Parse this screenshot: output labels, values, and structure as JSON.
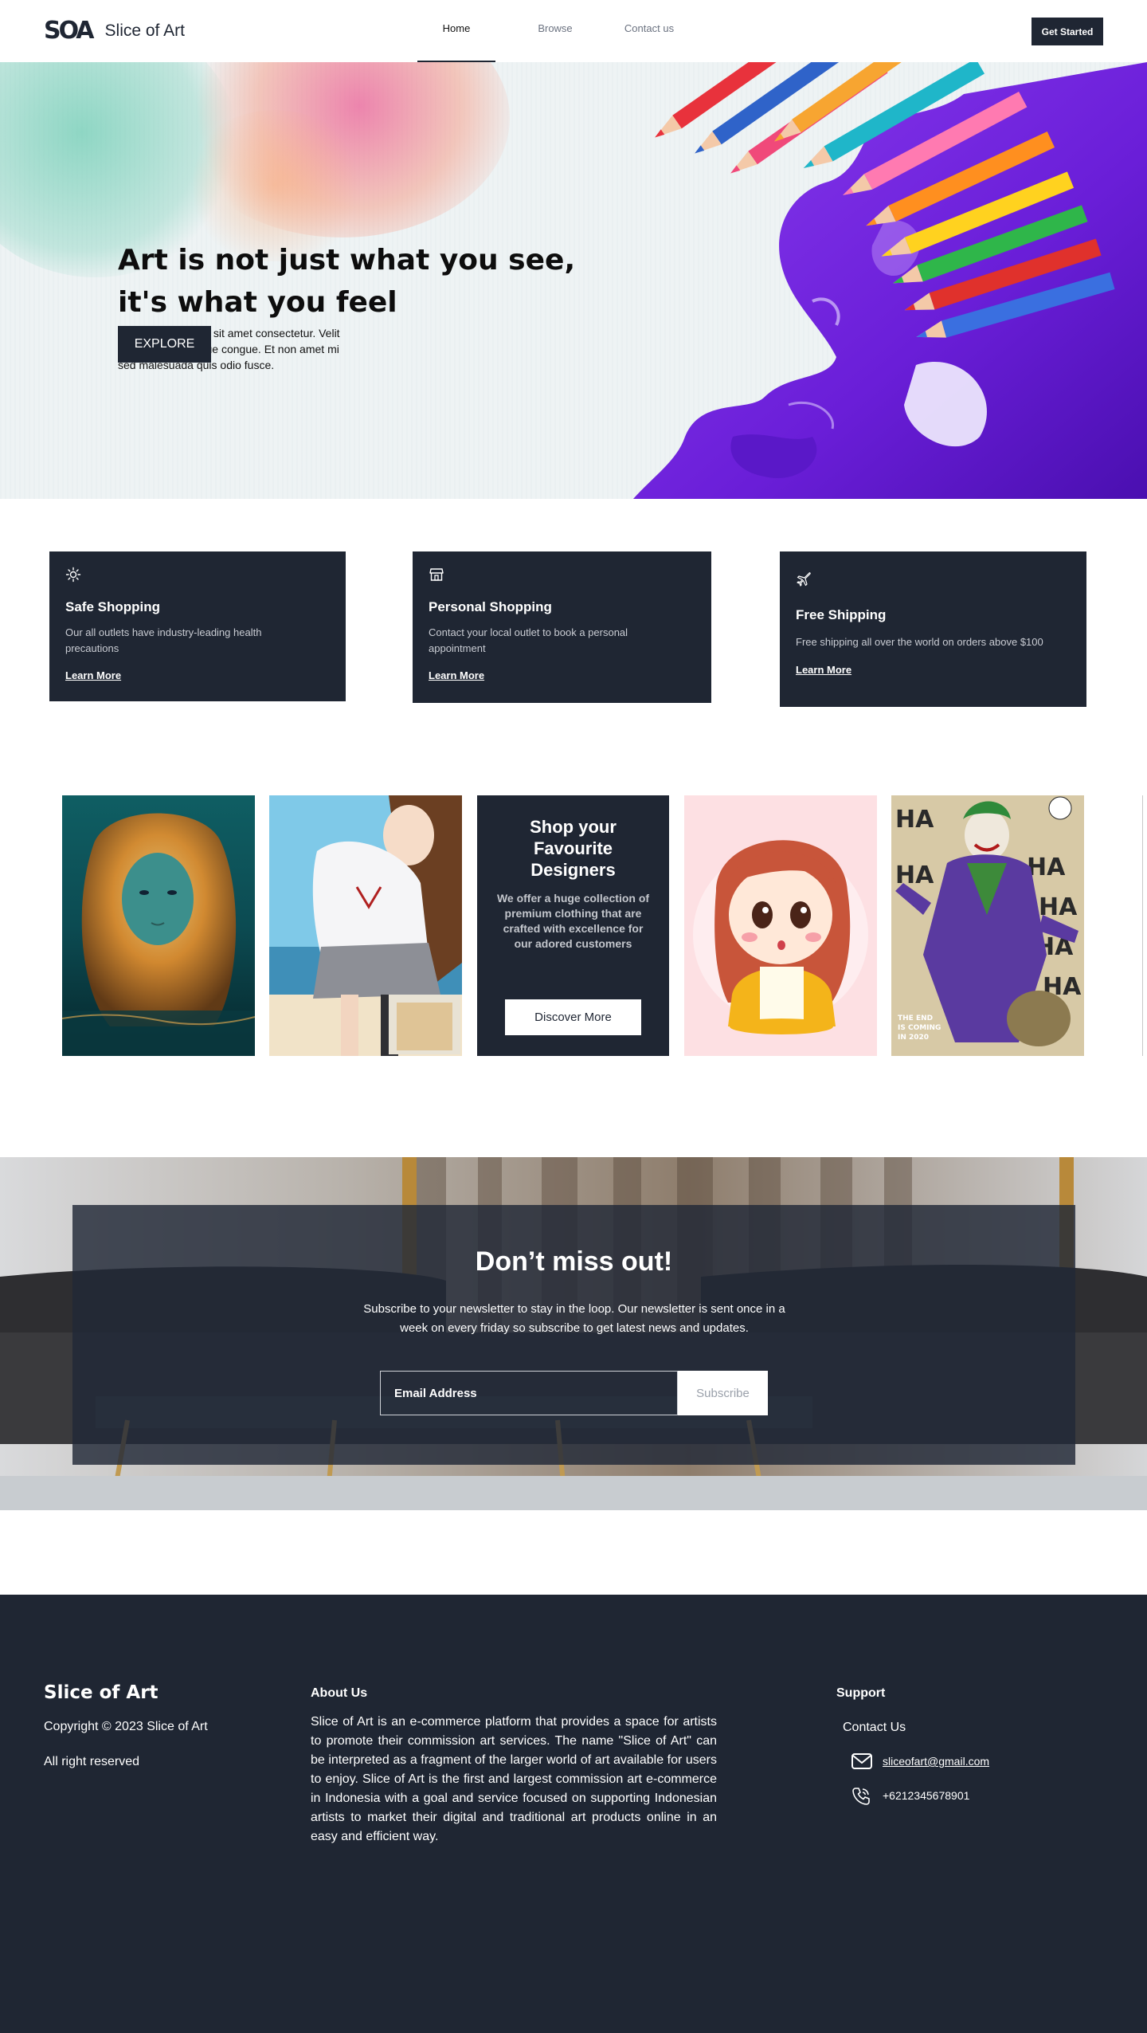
{
  "nav": {
    "logo_mark": "SOA",
    "logo_text": "Slice of Art",
    "links": [
      {
        "label": "Home",
        "active": true
      },
      {
        "label": "Browse",
        "active": false
      },
      {
        "label": "Contact us",
        "active": false
      }
    ],
    "cta_label": "Get Started"
  },
  "hero": {
    "title_line1": "Art is not just what you see,",
    "title_line2": "it's what you feel",
    "subtitle": "Lorem ipsum dolor sit amet consectetur. Velit non id turpis congue congue. Et non amet mi sed malesuada quis odio fusce.",
    "button_label": "EXPLORE"
  },
  "features": [
    {
      "icon": "sun-icon",
      "title": "Safe Shopping",
      "text": "Our all outlets have industry-leading health precautions",
      "link": "Learn More"
    },
    {
      "icon": "store-icon",
      "title": "Personal Shopping",
      "text": "Contact your local outlet to book a personal appointment",
      "link": "Learn More"
    },
    {
      "icon": "airplane-icon",
      "title": "Free Shipping",
      "text": "Free shipping all over the world on orders above $100",
      "link": "Learn More"
    }
  ],
  "gallery": {
    "promo_title_lines": [
      "Shop your",
      "Favourite",
      "Designers"
    ],
    "promo_text": "We offer a huge collection of premium clothing that are crafted with excellence for our adored customers",
    "promo_button": "Discover More",
    "comic_caption": "THE END IS COMING IN 2020"
  },
  "newsletter": {
    "title": "Don’t miss out!",
    "text": "Subscribe to your newsletter to stay in the loop. Our newsletter is sent once in a week on every friday so subscribe to get latest news and updates.",
    "input_label": "Email Address",
    "button_label": "Subscribe"
  },
  "footer": {
    "brand": "Slice of Art",
    "copyright": "Copyright © 2023 Slice of Art",
    "rights": "All right reserved",
    "about_heading": "About Us",
    "about_text": "Slice of Art is an e-commerce platform that provides a space for artists to promote their commission art services. The name \"Slice of Art\" can be interpreted as a fragment of the larger world of art available for users to enjoy. Slice of Art is the first and largest commission art e-commerce in Indonesia with a goal and service focused on supporting Indonesian artists to market their digital and traditional art products online in an easy and efficient way.",
    "support_heading": "Support",
    "contact_label": "Contact Us",
    "email": "sliceofart@gmail.com",
    "phone": "+6212345678901"
  },
  "colors": {
    "primary": "#1f2633",
    "white": "#ffffff",
    "muted_text": "#c9ccd3",
    "hero_purple": "#6a1ed8"
  }
}
